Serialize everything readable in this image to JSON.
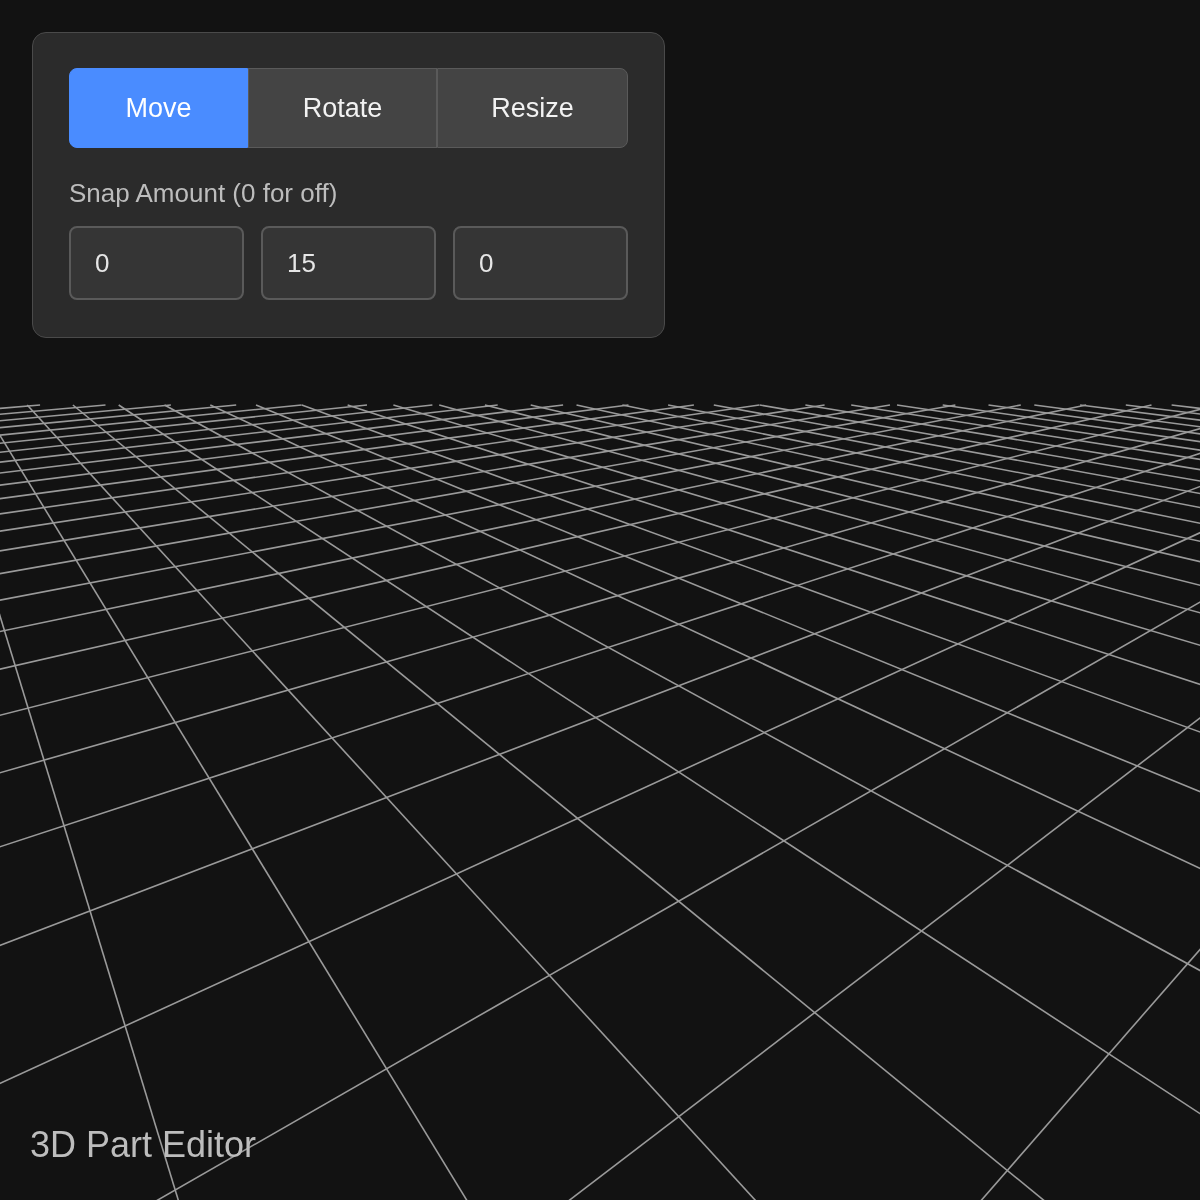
{
  "modes": [
    {
      "label": "Move",
      "selected": true
    },
    {
      "label": "Rotate",
      "selected": false
    },
    {
      "label": "Resize",
      "selected": false
    }
  ],
  "snap": {
    "label": "Snap Amount (0 for off)",
    "inputs": [
      {
        "value": "0"
      },
      {
        "value": "15"
      },
      {
        "value": "0"
      }
    ]
  },
  "footer": {
    "title": "3D Part Editor"
  }
}
